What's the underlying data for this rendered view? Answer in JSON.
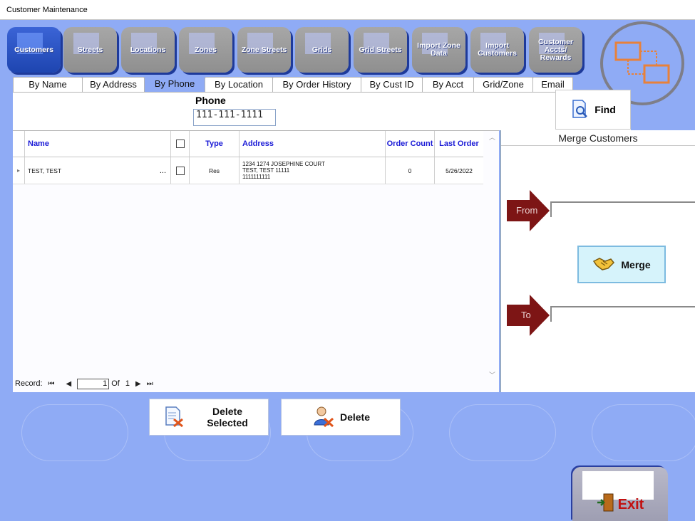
{
  "window": {
    "title": "Customer Maintenance"
  },
  "nav": [
    {
      "label": "Customers"
    },
    {
      "label": "Streets"
    },
    {
      "label": "Locations"
    },
    {
      "label": "Zones"
    },
    {
      "label": "Zone Streets"
    },
    {
      "label": "Grids"
    },
    {
      "label": "Grid Streets"
    },
    {
      "label": "Import Zone Data"
    },
    {
      "label": "Import Customers"
    },
    {
      "label": "Customer Accts/ Rewards"
    }
  ],
  "tabs": [
    {
      "label": "By Name"
    },
    {
      "label": "By Address"
    },
    {
      "label": "By Phone"
    },
    {
      "label": "By Location"
    },
    {
      "label": "By Order History"
    },
    {
      "label": "By Cust ID"
    },
    {
      "label": "By Acct"
    },
    {
      "label": "Grid/Zone"
    },
    {
      "label": "Email"
    }
  ],
  "search": {
    "label": "Phone",
    "value": "111-111-1111",
    "find_label": "Find"
  },
  "grid": {
    "columns": {
      "name": "Name",
      "type": "Type",
      "address": "Address",
      "order_count": "Order Count",
      "last_order": "Last Order"
    },
    "rows": [
      {
        "name": "TEST, TEST",
        "ellipsis": "...",
        "type": "Res",
        "address_line1": "1234 1274 JOSEPHINE COURT",
        "address_line2": "TEST, TEST 11111",
        "address_line3": "1111111111",
        "order_count": "0",
        "last_order": "5/26/2022"
      }
    ],
    "record": {
      "label": "Record:",
      "current": "1",
      "of_label": "Of",
      "total": "1"
    }
  },
  "merge": {
    "title": "Merge Customers",
    "from_label": "From",
    "to_label": "To",
    "merge_label": "Merge"
  },
  "actions": {
    "delete_selected": "Delete Selected",
    "delete": "Delete",
    "exit": "Exit"
  },
  "colors": {
    "background": "#8fabf5",
    "active_nav": "#1e45b0",
    "arrow": "#7d1515",
    "header_text": "#1a1ad6",
    "exit_text": "#c21111"
  }
}
